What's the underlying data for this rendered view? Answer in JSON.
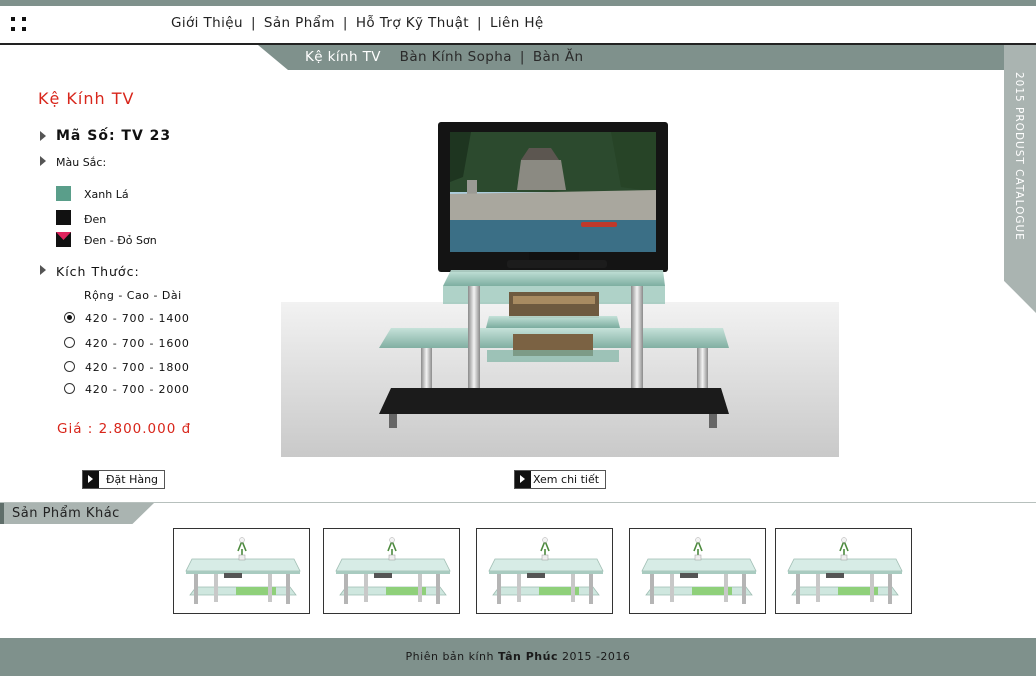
{
  "colors": {
    "accent_red": "#d8261b",
    "nav_gray": "#7f918c",
    "tab_gray": "#aab4b1"
  },
  "nav": {
    "items": [
      "Giới Thiệu",
      "Sản Phẩm",
      "Hỗ Trợ Kỹ Thuật",
      "Liên Hệ"
    ],
    "separator": "|"
  },
  "subnav": {
    "items": [
      "Kệ kính TV",
      "Bàn Kính Sopha",
      "Bàn Ăn"
    ],
    "separator": "|",
    "active": "Kệ kính TV"
  },
  "side_tab": {
    "label": "2015 PRODUST CATALOGUE"
  },
  "product": {
    "category": "Kệ Kính TV",
    "code_label": "Mã Số: TV 23",
    "color_label": "Màu Sắc:",
    "colors": [
      {
        "name": "Xanh Lá",
        "swatch": "#5a9e8a"
      },
      {
        "name": "Đen",
        "swatch": "#111111"
      },
      {
        "name": "Đen - Đỏ Sơn",
        "swatch": "#111111",
        "accent": "#e0245e"
      }
    ],
    "size_label": "Kích Thước:",
    "dims_header": "Rộng - Cao - Dài",
    "sizes": [
      "420 - 700 - 1400",
      "420 - 700 - 1600",
      "420 - 700 - 1800",
      "420 - 700 - 2000"
    ],
    "selected_size": "420 - 700 - 1400",
    "price": "Giá : 2.800.000 đ"
  },
  "buttons": {
    "order": "Đặt Hàng",
    "details": "Xem chi tiết"
  },
  "other": {
    "title": "Sản Phẩm Khác",
    "count": 5
  },
  "footer": {
    "prefix": "Phiên bản kính",
    "brand": "Tân Phúc",
    "years": "2015 -2016"
  }
}
